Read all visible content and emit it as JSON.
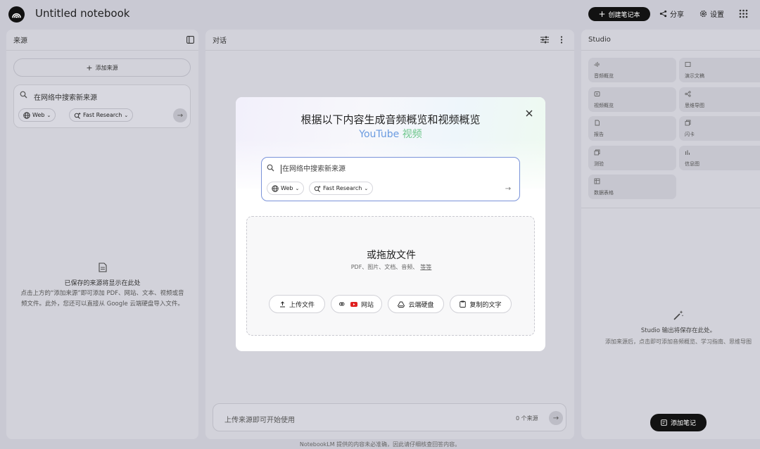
{
  "header": {
    "title": "Untitled notebook",
    "create_label": "创建笔记本",
    "share_label": "分享",
    "settings_label": "设置"
  },
  "sources": {
    "title": "来源",
    "add_label": "添加来源",
    "search_placeholder": "在网络中搜索新来源",
    "web_chip": "Web",
    "research_chip": "Fast Research",
    "empty_title": "已保存的来源将显示在此处",
    "empty_desc_line1": "点击上方的“添加来源”即可添加 PDF、网站、文本、视频或音",
    "empty_desc_line2": "频文件。此外，您还可以直接从 Google 云端硬盘导入文件。"
  },
  "chat": {
    "title": "对话",
    "input_placeholder": "上传来源即可开始使用",
    "source_count": "0 个来源"
  },
  "studio": {
    "title": "Studio",
    "tiles": [
      {
        "label": "音频概览",
        "icon": "audio-waveform-icon"
      },
      {
        "label": "演示文稿",
        "icon": "slides-icon"
      },
      {
        "label": "视频概览",
        "icon": "video-icon"
      },
      {
        "label": "思维导图",
        "icon": "mind-map-icon"
      },
      {
        "label": "报告",
        "icon": "report-icon"
      },
      {
        "label": "闪卡",
        "icon": "flashcards-icon"
      },
      {
        "label": "测验",
        "icon": "quiz-icon"
      },
      {
        "label": "信息图",
        "icon": "infographic-icon"
      },
      {
        "label": "数据表格",
        "icon": "data-table-icon"
      }
    ],
    "empty_title": "Studio 输出将保存在此处。",
    "empty_desc": "添加来源后，点击即可添加音频概览、学习指南、思维导图",
    "add_note_label": "添加笔记"
  },
  "modal": {
    "title": "根据以下内容生成音频概览和视频概览",
    "subtitle_part1": "YouTube",
    "subtitle_part2": "视频",
    "search_placeholder": "在网络中搜索新来源",
    "web_chip": "Web",
    "research_chip": "Fast Research",
    "drop_title": "或拖放文件",
    "drop_types": "PDF、图片、文档、音频、",
    "drop_more": "等等",
    "buttons": {
      "upload": "上传文件",
      "website": "网站",
      "drive": "云端硬盘",
      "paste": "复制的文字"
    }
  },
  "footer": {
    "note": "NotebookLM 提供的内容未必准确，因此请仔细核查回答内容。"
  }
}
